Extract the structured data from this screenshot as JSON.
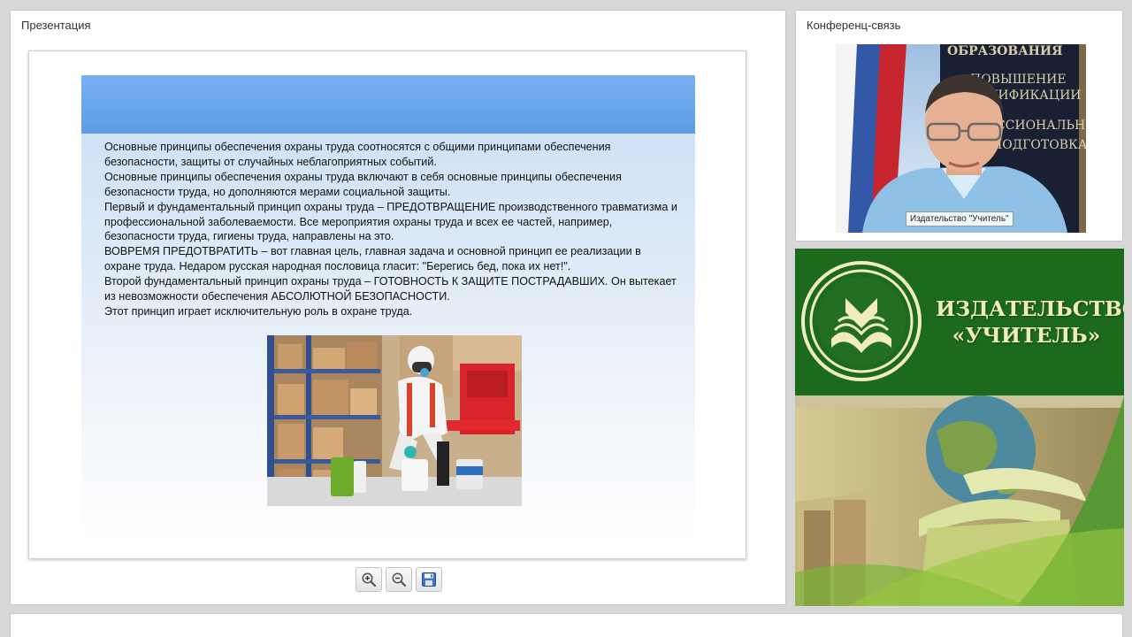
{
  "presentation": {
    "title": "Презентация",
    "slide": {
      "paragraphs": [
        "Основные принципы обеспечения охраны труда соотносятся с общими принципами обеспечения безопасности, защиты от случайных неблагоприятных событий.",
        "Основные принципы обеспечения охраны труда включают в себя основные принципы обеспечения безопасности труда, но дополняются мерами социальной защиты.",
        "Первый и фундаментальный принцип охраны труда – ПРЕДОТВРАЩЕНИЕ производственного травматизма и профессиональной заболеваемости. Все мероприятия охраны труда и всех ее частей, например, безопасности труда, гигиены труда, направлены на это.",
        "ВОВРЕМЯ ПРЕДОТВРАТИТЬ – вот главная цель, главная задача и основной принцип ее реализации в охране труда. Недаром русская народная пословица гласит: \"Берегись бед, пока их нет!\".",
        "Второй фундаментальный принцип охраны труда – ГОТОВНОСТЬ К ЗАЩИТЕ ПОСТРАДАВШИХ. Он вытекает из невозможности обеспечения АБСОЛЮТНОЙ БЕЗОПАСНОСТИ.",
        "Этот принцип играет исключительную роль в охране труда."
      ]
    },
    "toolbar": {
      "zoom_in_icon": "zoom-in-icon",
      "zoom_out_icon": "zoom-out-icon",
      "save_icon": "save-icon"
    }
  },
  "conference": {
    "title": "Конференц-связь",
    "participant_label": "Издательство \"Учитель\"",
    "backdrop_text": [
      "ОБРАЗОВАНИЯ",
      "ПОВЫШЕНИЕ",
      "КВАЛИФИКАЦИИ",
      "ПРОФЕССИОНАЛЬНАЯ",
      "ПЕРЕПОДГОТОВКА"
    ]
  },
  "banner": {
    "name_line1": "ИЗДАТЕЛЬСТВО",
    "name_line2": "«УЧИТЕЛЬ»",
    "colors": {
      "green": "#1c6a1b",
      "cream": "#f1ecc0"
    }
  }
}
